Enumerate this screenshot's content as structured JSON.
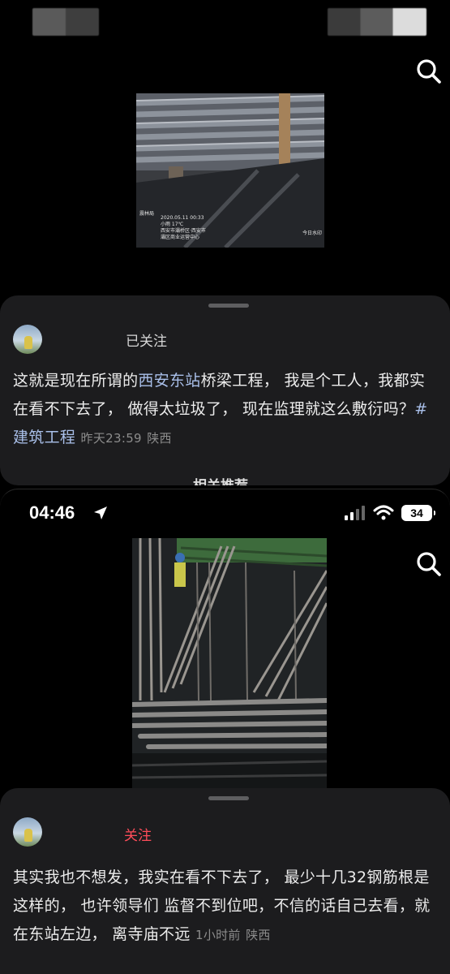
{
  "post1": {
    "follow_label": "已关注",
    "text_intro": "这就是现在所谓的",
    "location_link": "西安东站",
    "text_main": "桥梁工程， 我是个工人，我都实在看不下去了， 做得太垃圾了， 现在监理就这么敷衍吗？",
    "hashtag": "#建筑工程",
    "timestamp": "昨天23:59",
    "region": "陕西",
    "related_label": "相关推荐",
    "photo_watermark": {
      "line1": "震林局",
      "line2": "2020.05.11 00:33",
      "line3": "小雨 17℃",
      "line4": "西安市灞桥区·西安市",
      "line5": "灞区商业运营中心",
      "brand": "今日水印"
    }
  },
  "status_bar": {
    "time": "04:46",
    "battery": "34"
  },
  "post2": {
    "follow_label": "关注",
    "text": "其实我也不想发，我实在看不下去了， 最少十几32钢筋根是这样的， 也许领导们 监督不到位吧，不信的话自己去看，就在东站左边， 离寺庙不远",
    "timestamp": "1小时前",
    "region": "陕西"
  },
  "colors": {
    "link": "#a9bfe9",
    "follow_red": "#ff4d5a",
    "sheet_bg": "#1c1c1e"
  },
  "icons": {
    "search": "search-icon",
    "location_arrow": "location-arrow-icon",
    "signal": "signal-icon",
    "wifi": "wifi-icon",
    "battery": "battery-icon"
  }
}
